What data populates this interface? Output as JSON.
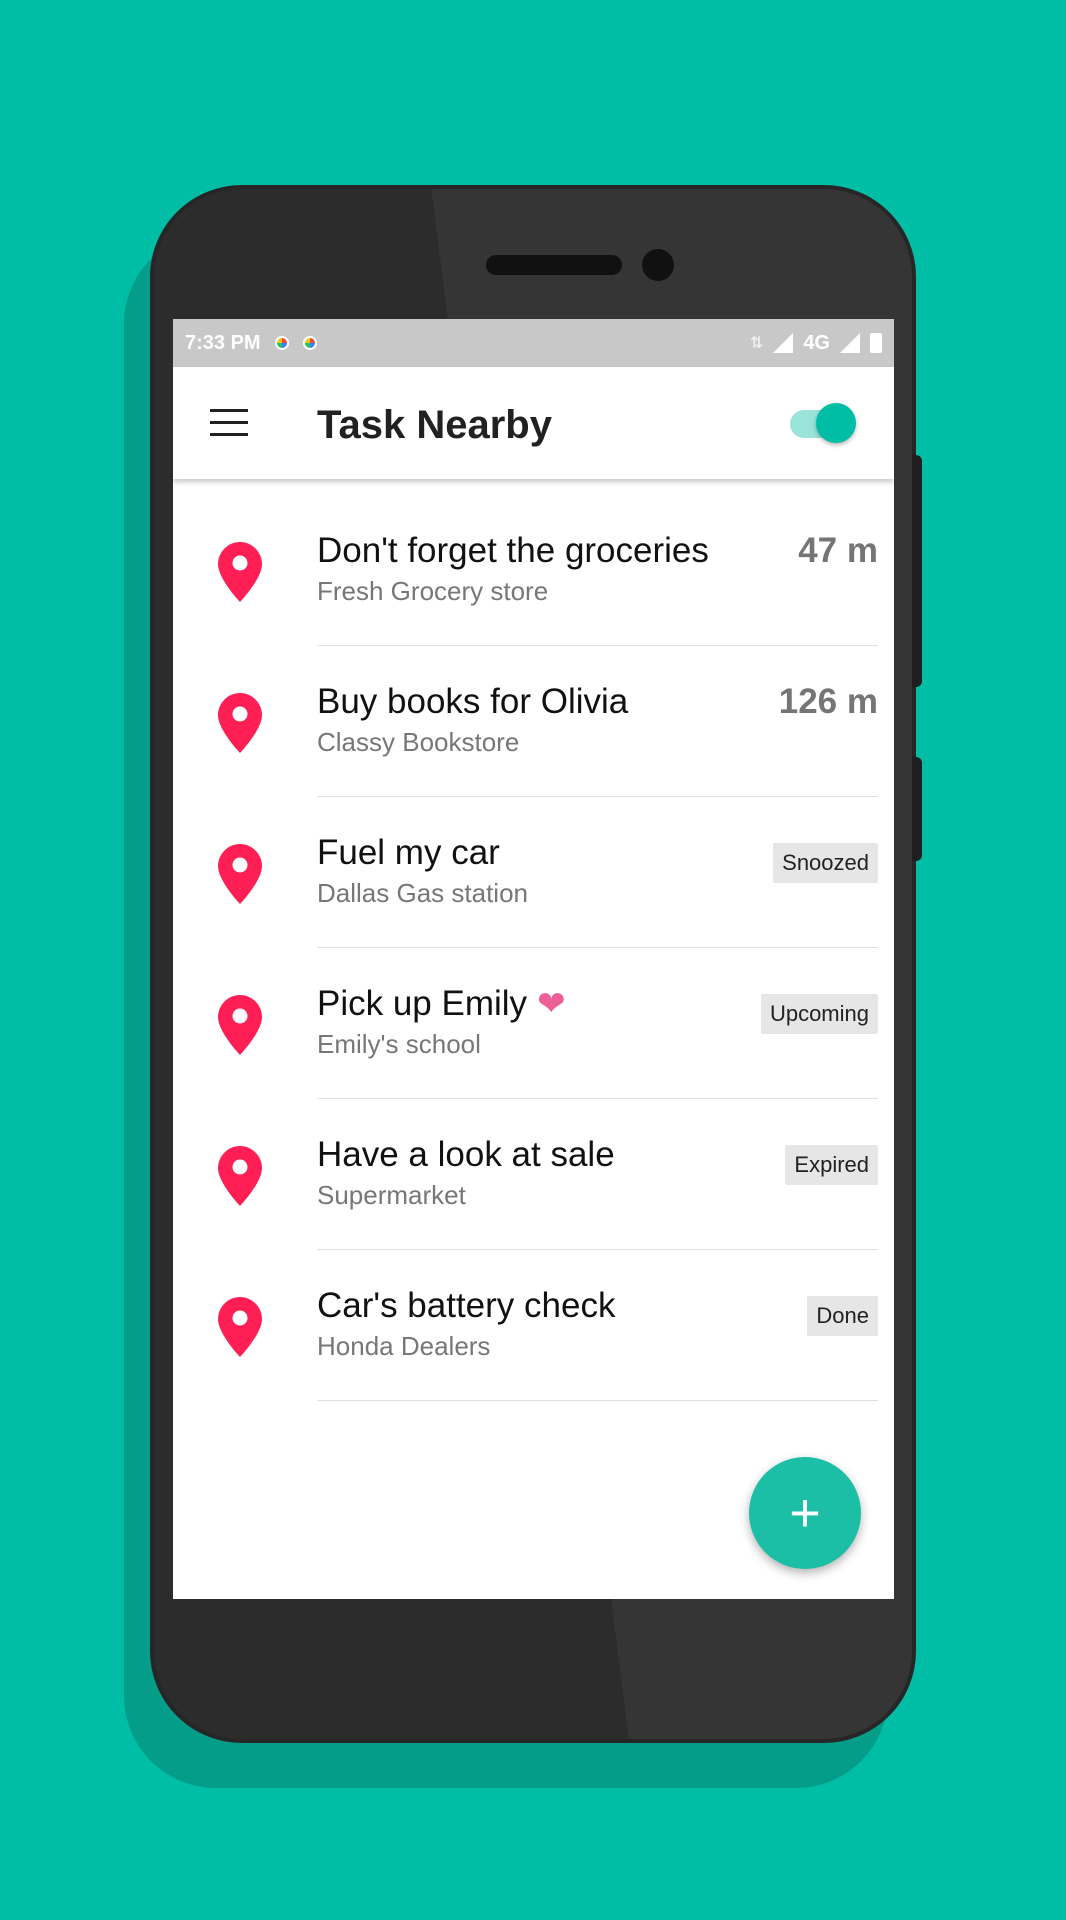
{
  "statusbar": {
    "time": "7:33 PM",
    "network": "4G"
  },
  "appbar": {
    "title": "Task Nearby",
    "toggle_on": true
  },
  "tasks": [
    {
      "title": "Don't forget the groceries",
      "place": "Fresh Grocery store",
      "distance": "47 m"
    },
    {
      "title": "Buy books for Olivia",
      "place": "Classy Bookstore",
      "distance": "126 m"
    },
    {
      "title": "Fuel my car",
      "place": "Dallas Gas station",
      "status": "Snoozed"
    },
    {
      "title": "Pick up Emily",
      "place": "Emily's school",
      "status": "Upcoming",
      "icon": "heart-icon"
    },
    {
      "title": "Have a look at sale",
      "place": "Supermarket",
      "status": "Expired"
    },
    {
      "title": "Car's battery check",
      "place": "Honda Dealers",
      "status": "Done"
    }
  ],
  "fab": {
    "label": "+"
  },
  "colors": {
    "background": "#00BDA5",
    "accent": "#00BDA5",
    "pin": "#FF1F55",
    "heart": "#EC5F97"
  }
}
